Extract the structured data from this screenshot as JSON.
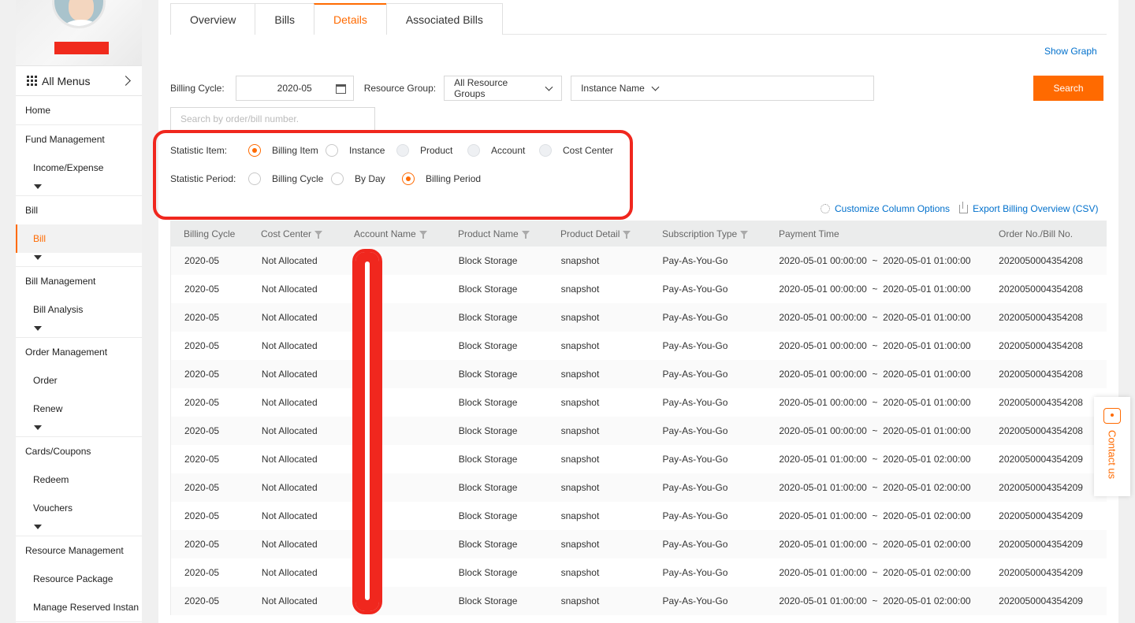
{
  "sidebar": {
    "menu_title": "All Menus",
    "items": [
      {
        "label": "Home",
        "type": "top"
      },
      {
        "label": "Fund Management",
        "type": "top"
      },
      {
        "label": "Income/Expense",
        "type": "sub"
      },
      {
        "label": "Bill",
        "type": "top"
      },
      {
        "label": "Bill",
        "type": "sub",
        "active": true
      },
      {
        "label": "Bill Management",
        "type": "top"
      },
      {
        "label": "Bill Analysis",
        "type": "sub"
      },
      {
        "label": "Order Management",
        "type": "top"
      },
      {
        "label": "Order",
        "type": "sub"
      },
      {
        "label": "Renew",
        "type": "sub"
      },
      {
        "label": "Cards/Coupons",
        "type": "top"
      },
      {
        "label": "Redeem",
        "type": "sub"
      },
      {
        "label": "Vouchers",
        "type": "sub"
      },
      {
        "label": "Resource Management",
        "type": "top"
      },
      {
        "label": "Resource Package",
        "type": "sub"
      },
      {
        "label": "Manage Reserved Instan",
        "type": "sub"
      }
    ]
  },
  "tabs": [
    {
      "label": "Overview",
      "active": false
    },
    {
      "label": "Bills",
      "active": false
    },
    {
      "label": "Details",
      "active": true
    },
    {
      "label": "Associated Bills",
      "active": false
    }
  ],
  "show_graph": "Show Graph",
  "filters": {
    "billing_cycle_label": "Billing Cycle:",
    "billing_cycle_value": "2020-05",
    "resource_group_label": "Resource Group:",
    "resource_group_value": "All Resource Groups",
    "instance_name_value": "Instance Name",
    "search_label": "Search",
    "order_placeholder": "Search by order/bill number."
  },
  "statistic_item": {
    "label": "Statistic Item:",
    "options": [
      {
        "label": "Billing Item",
        "state": "checked"
      },
      {
        "label": "Instance",
        "state": "normal"
      },
      {
        "label": "Product",
        "state": "disabled"
      },
      {
        "label": "Account",
        "state": "disabled"
      },
      {
        "label": "Cost Center",
        "state": "disabled"
      }
    ]
  },
  "statistic_period": {
    "label": "Statistic Period:",
    "options": [
      {
        "label": "Billing Cycle",
        "state": "normal"
      },
      {
        "label": "By Day",
        "state": "normal"
      },
      {
        "label": "Billing Period",
        "state": "checked"
      }
    ]
  },
  "tools": {
    "customize_label": "Customize Column Options",
    "export_label": "Export Billing Overview (CSV)"
  },
  "table": {
    "headers": [
      "Billing Cycle",
      "Cost Center",
      "Account Name",
      "Product Name",
      "Product Detail",
      "Subscription Type",
      "Payment Time",
      "Order No./Bill No."
    ],
    "filterable": [
      false,
      true,
      true,
      true,
      true,
      true,
      false,
      false
    ],
    "rows": [
      [
        "2020-05",
        "Not Allocated",
        "",
        "Block Storage",
        "snapshot",
        "Pay-As-You-Go",
        "2020-05-01 00:00:00  ~  2020-05-01 01:00:00",
        "2020050004354208"
      ],
      [
        "2020-05",
        "Not Allocated",
        "",
        "Block Storage",
        "snapshot",
        "Pay-As-You-Go",
        "2020-05-01 00:00:00  ~  2020-05-01 01:00:00",
        "2020050004354208"
      ],
      [
        "2020-05",
        "Not Allocated",
        "",
        "Block Storage",
        "snapshot",
        "Pay-As-You-Go",
        "2020-05-01 00:00:00  ~  2020-05-01 01:00:00",
        "2020050004354208"
      ],
      [
        "2020-05",
        "Not Allocated",
        "",
        "Block Storage",
        "snapshot",
        "Pay-As-You-Go",
        "2020-05-01 00:00:00  ~  2020-05-01 01:00:00",
        "2020050004354208"
      ],
      [
        "2020-05",
        "Not Allocated",
        "",
        "Block Storage",
        "snapshot",
        "Pay-As-You-Go",
        "2020-05-01 00:00:00  ~  2020-05-01 01:00:00",
        "2020050004354208"
      ],
      [
        "2020-05",
        "Not Allocated",
        "",
        "Block Storage",
        "snapshot",
        "Pay-As-You-Go",
        "2020-05-01 00:00:00  ~  2020-05-01 01:00:00",
        "2020050004354208"
      ],
      [
        "2020-05",
        "Not Allocated",
        "",
        "Block Storage",
        "snapshot",
        "Pay-As-You-Go",
        "2020-05-01 00:00:00  ~  2020-05-01 01:00:00",
        "2020050004354208"
      ],
      [
        "2020-05",
        "Not Allocated",
        "",
        "Block Storage",
        "snapshot",
        "Pay-As-You-Go",
        "2020-05-01 01:00:00  ~  2020-05-01 02:00:00",
        "2020050004354209"
      ],
      [
        "2020-05",
        "Not Allocated",
        "",
        "Block Storage",
        "snapshot",
        "Pay-As-You-Go",
        "2020-05-01 01:00:00  ~  2020-05-01 02:00:00",
        "2020050004354209"
      ],
      [
        "2020-05",
        "Not Allocated",
        "",
        "Block Storage",
        "snapshot",
        "Pay-As-You-Go",
        "2020-05-01 01:00:00  ~  2020-05-01 02:00:00",
        "2020050004354209"
      ],
      [
        "2020-05",
        "Not Allocated",
        "",
        "Block Storage",
        "snapshot",
        "Pay-As-You-Go",
        "2020-05-01 01:00:00  ~  2020-05-01 02:00:00",
        "2020050004354209"
      ],
      [
        "2020-05",
        "Not Allocated",
        "",
        "Block Storage",
        "snapshot",
        "Pay-As-You-Go",
        "2020-05-01 01:00:00  ~  2020-05-01 02:00:00",
        "2020050004354209"
      ],
      [
        "2020-05",
        "Not Allocated",
        "",
        "Block Storage",
        "snapshot",
        "Pay-As-You-Go",
        "2020-05-01 01:00:00  ~  2020-05-01 02:00:00",
        "2020050004354209"
      ]
    ]
  },
  "contact": {
    "label": "Contact us",
    "icon": "hexagon-icon"
  },
  "colors": {
    "accent": "#ff6a00",
    "link": "#0070cc",
    "annotation": "#f0271e"
  }
}
